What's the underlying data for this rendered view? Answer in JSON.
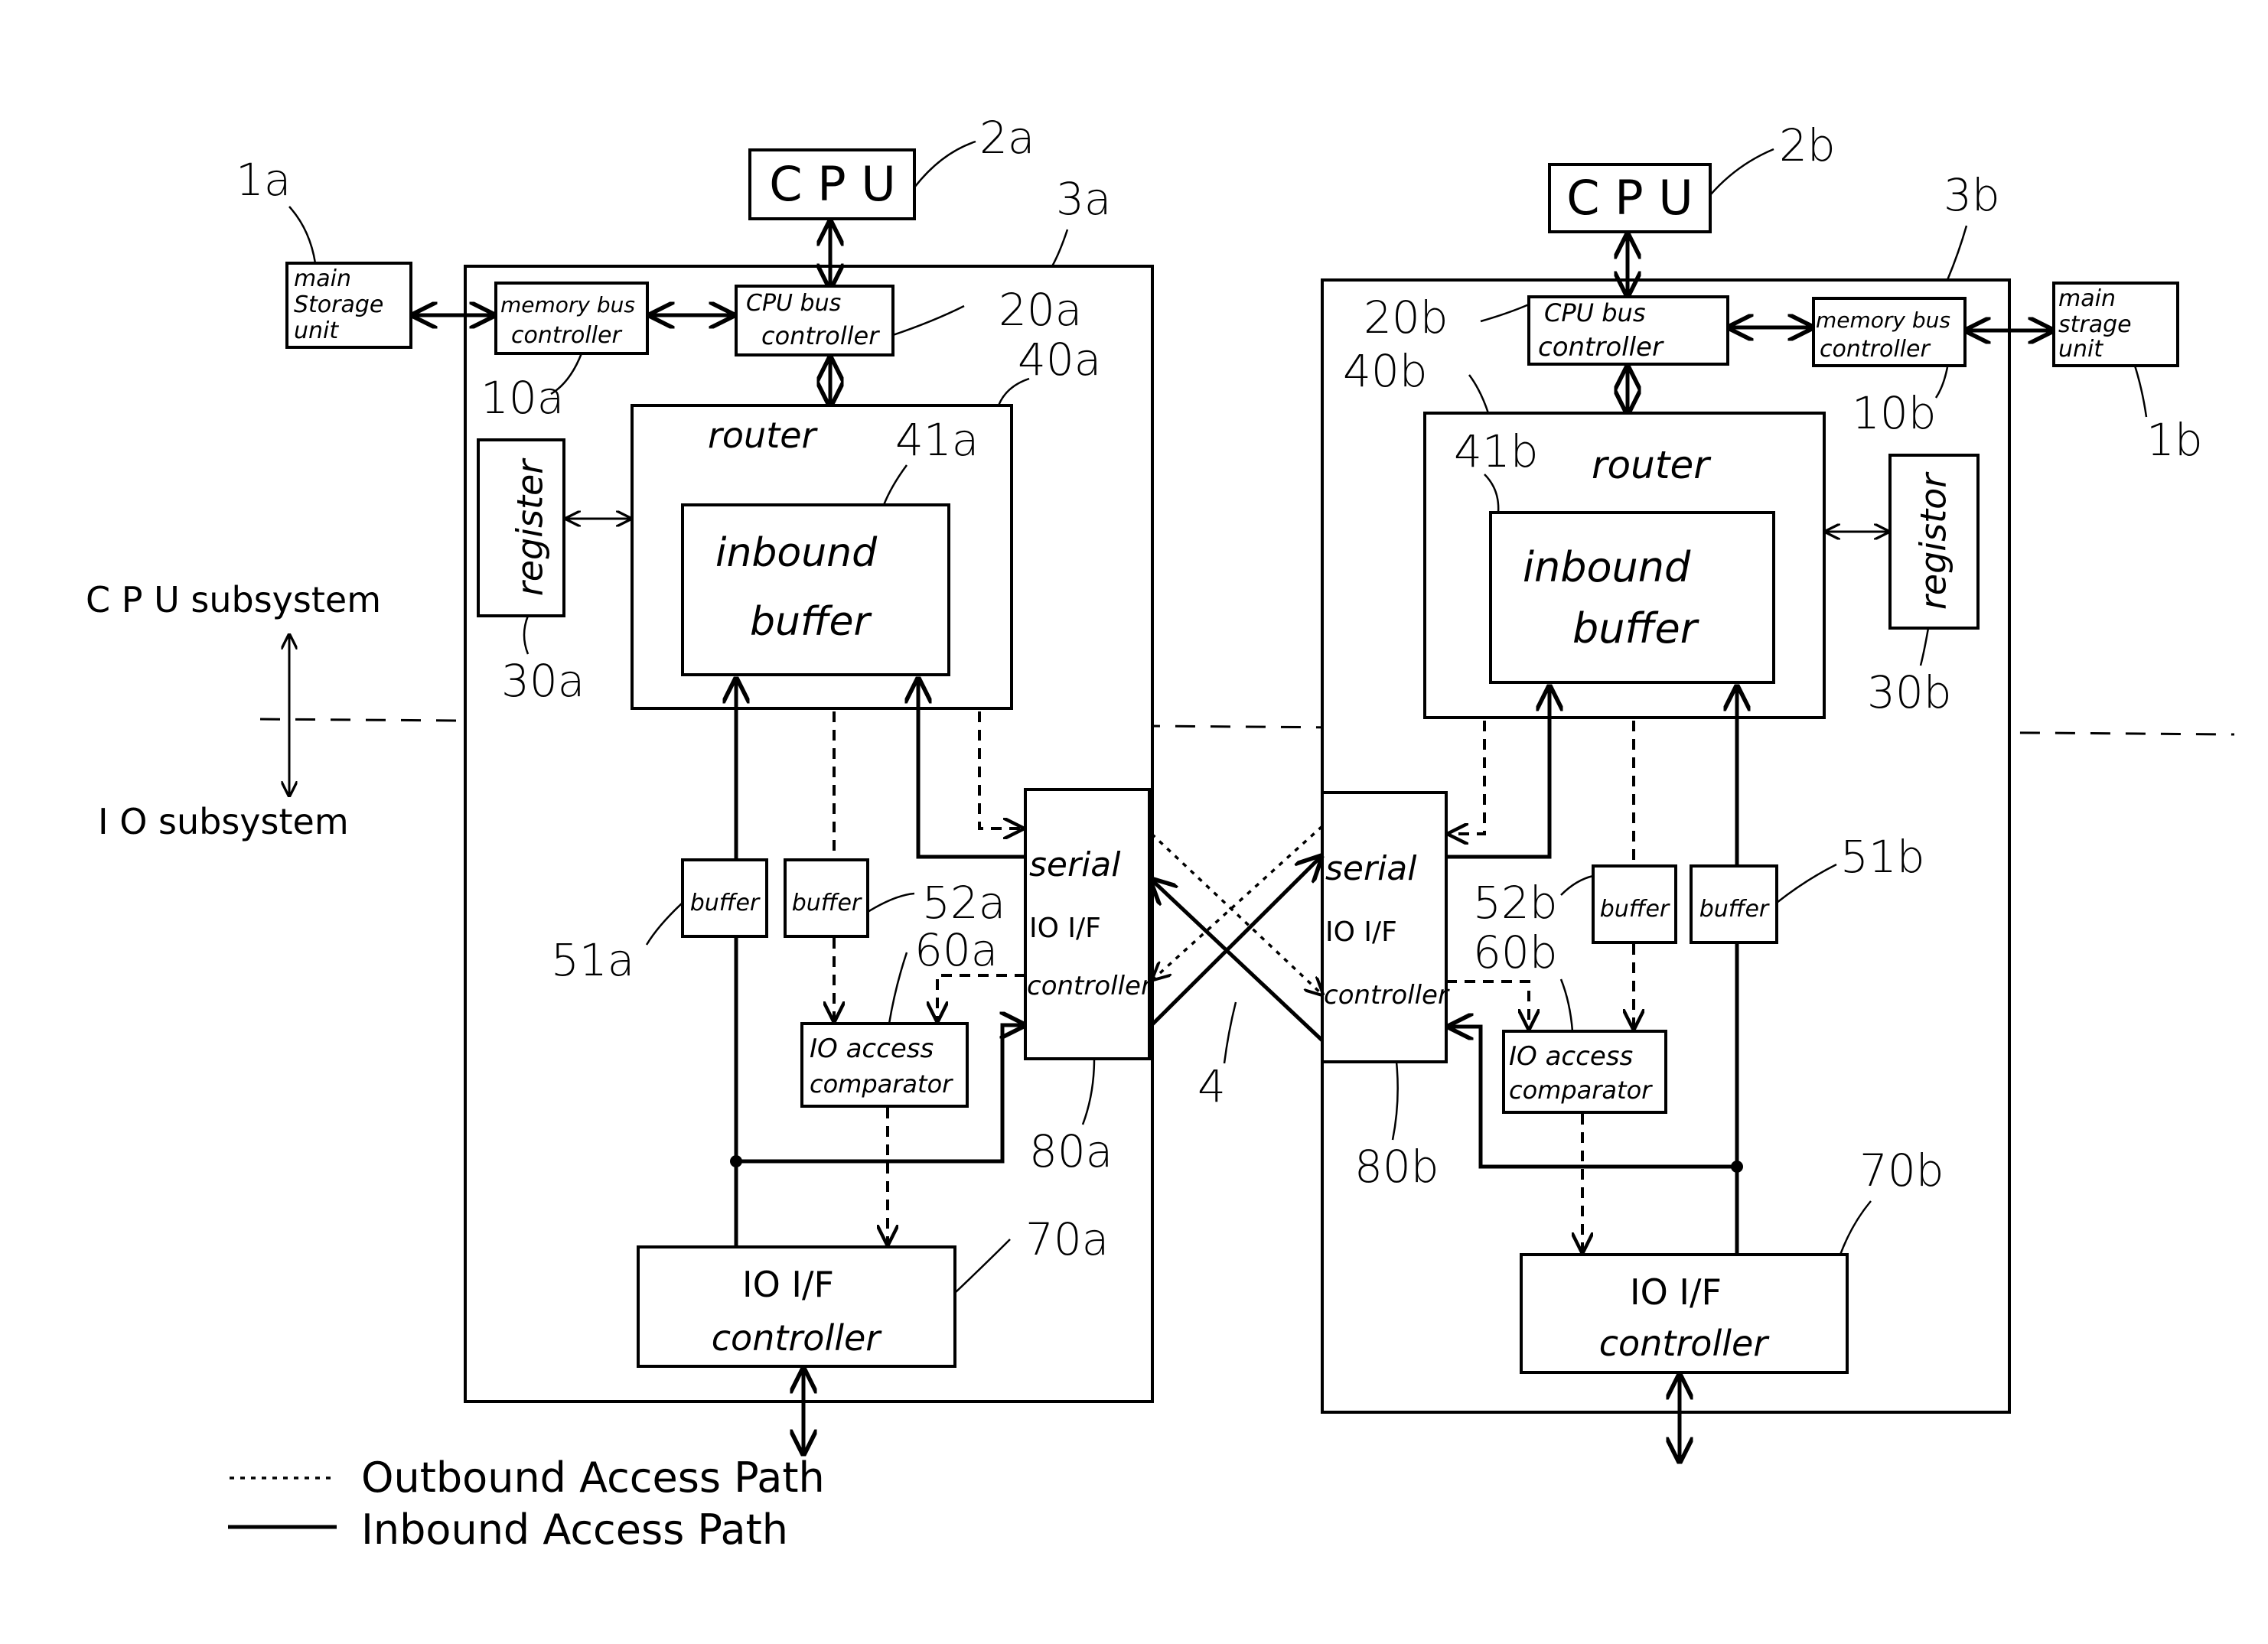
{
  "side_labels": {
    "cpu_subsystem": "C P U subsystem",
    "io_subsystem": "I O subsystem"
  },
  "system_a": {
    "cpu": {
      "label": "C P U",
      "ref": "2a"
    },
    "main_storage": {
      "lines": [
        "main",
        "Storage",
        "unit"
      ],
      "ref": "1a"
    },
    "node_ref": "3a",
    "memory_bus_controller": {
      "lines": [
        "memory bus",
        "controller"
      ],
      "ref": "10a"
    },
    "cpu_bus_controller": {
      "lines": [
        "CPU bus",
        "controller"
      ],
      "ref": "20a"
    },
    "router": {
      "label": "router",
      "ref": "40a"
    },
    "inbound_buffer": {
      "lines": [
        "inbound",
        "buffer"
      ],
      "ref": "41a"
    },
    "register": {
      "label": "register",
      "ref": "30a"
    },
    "buffer_inbound": {
      "label": "buffer",
      "ref": "51a"
    },
    "buffer_outbound": {
      "label": "buffer",
      "ref": "52a"
    },
    "io_access_comparator": {
      "lines": [
        "IO access",
        "comparator"
      ],
      "ref": "60a"
    },
    "serial_io_if_controller": {
      "lines": [
        "serial",
        "IO I/F",
        "controller"
      ],
      "ref": "80a"
    },
    "io_if_controller": {
      "lines": [
        "IO I/F",
        "controller"
      ],
      "ref": "70a"
    }
  },
  "system_b": {
    "cpu": {
      "label": "C P U",
      "ref": "2b"
    },
    "main_storage": {
      "lines": [
        "main",
        "strage",
        "unit"
      ],
      "ref": "1b"
    },
    "node_ref": "3b",
    "memory_bus_controller": {
      "lines": [
        "memory bus",
        "controller"
      ],
      "ref": "10b"
    },
    "cpu_bus_controller": {
      "lines": [
        "CPU bus",
        "controller"
      ],
      "ref": "20b"
    },
    "router": {
      "label": "router",
      "ref": "40b"
    },
    "inbound_buffer": {
      "lines": [
        "inbound",
        "buffer"
      ],
      "ref": "41b"
    },
    "register": {
      "label": "registor",
      "ref": "30b"
    },
    "buffer_inbound": {
      "label": "buffer",
      "ref": "51b"
    },
    "buffer_outbound": {
      "label": "buffer",
      "ref": "52b"
    },
    "io_access_comparator": {
      "lines": [
        "IO access",
        "comparator"
      ],
      "ref": "60b"
    },
    "serial_io_if_controller": {
      "lines": [
        "serial",
        "IO I/F",
        "controller"
      ],
      "ref": "80b"
    },
    "io_if_controller": {
      "lines": [
        "IO I/F",
        "controller"
      ],
      "ref": "70b"
    }
  },
  "link_ref": "4",
  "legend": {
    "outbound": "Outbound Access Path",
    "inbound": "Inbound Access Path"
  }
}
